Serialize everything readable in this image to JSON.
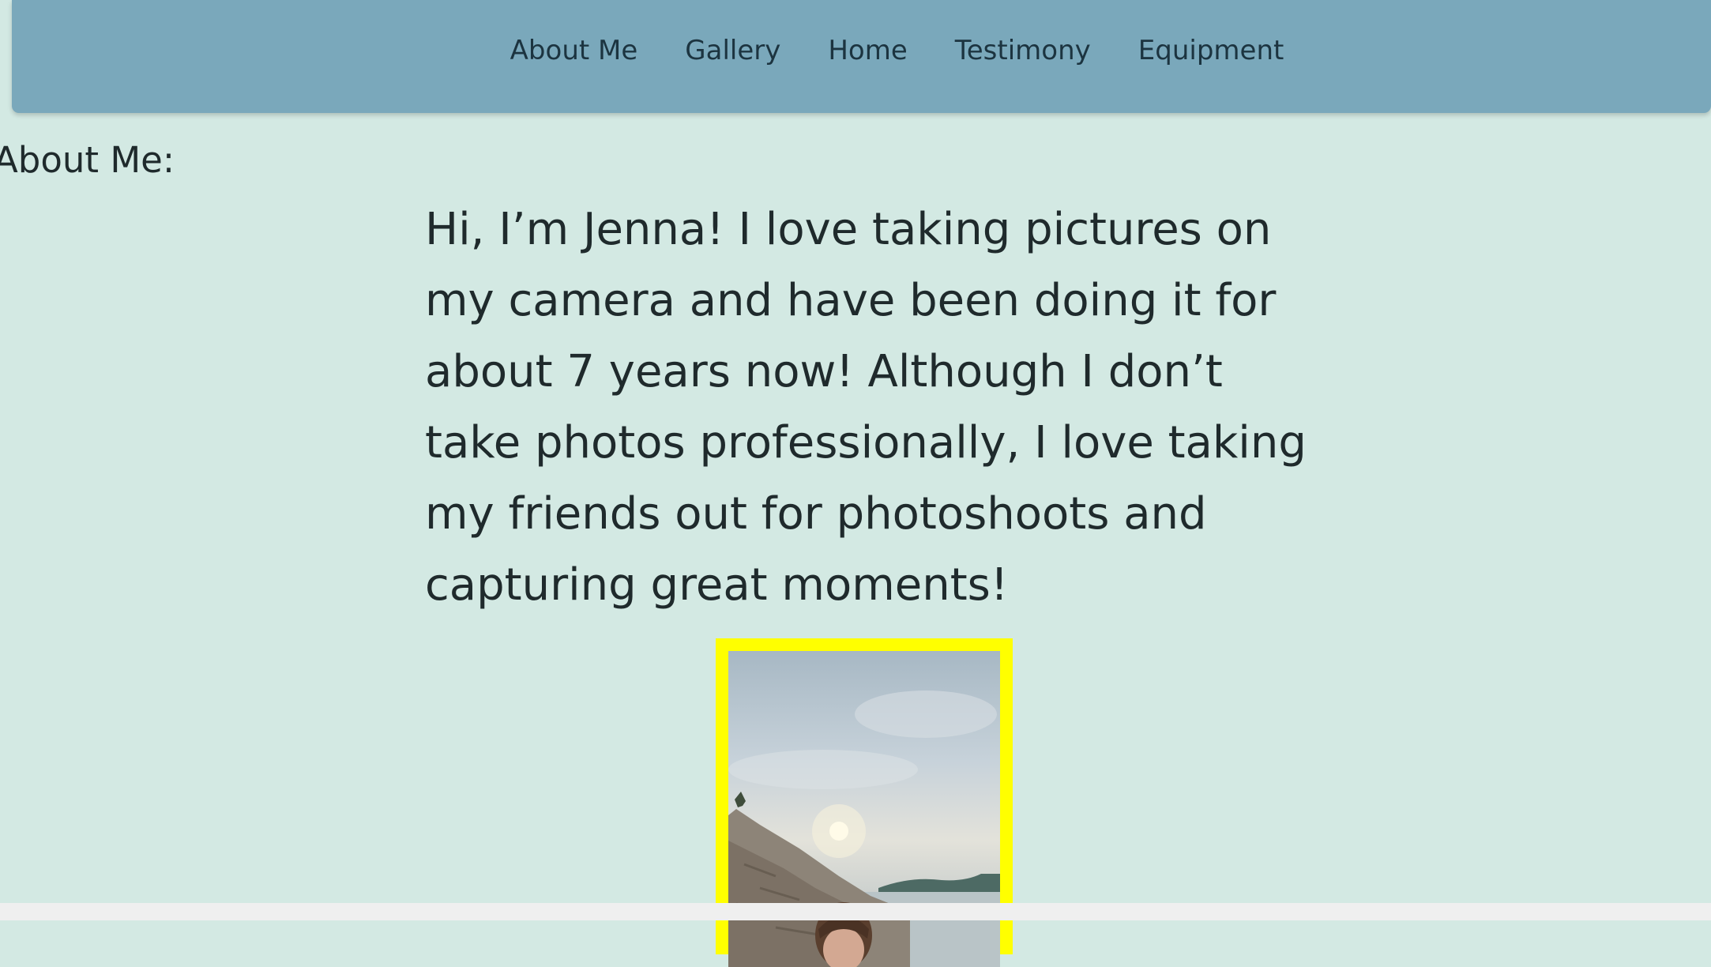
{
  "nav": {
    "items": [
      {
        "label": "About Me"
      },
      {
        "label": "Gallery"
      },
      {
        "label": "Home"
      },
      {
        "label": "Testimony"
      },
      {
        "label": "Equipment"
      }
    ]
  },
  "about": {
    "heading": "About Me:",
    "intro": "Hi, I’m Jenna! I love taking pictures on my camera and have been doing it for about 7 years now! Although I don’t take photos professionally, I love taking my friends out for photoshoots and capturing great moments!"
  },
  "colors": {
    "page_background": "#d3e9e3",
    "nav_background": "#7aa8bb",
    "photo_border": "#ffff00",
    "text": "#1f2a2c"
  }
}
